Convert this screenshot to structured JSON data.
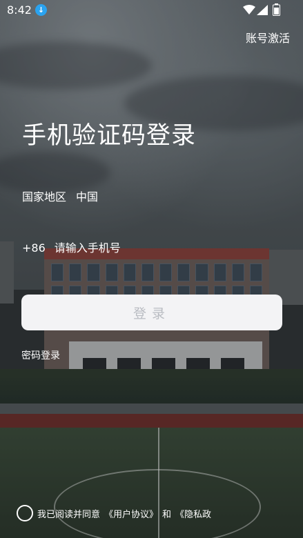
{
  "status_bar": {
    "time": "8:42",
    "download_icon": "download-icon",
    "wifi_icon": "wifi-icon",
    "signal_icon": "signal-icon",
    "battery_icon": "battery-icon"
  },
  "header": {
    "account_activate": "账号激活"
  },
  "main": {
    "title": "手机验证码登录",
    "region_label": "国家地区",
    "region_value": "中国",
    "country_code": "+86",
    "phone_placeholder": "请输入手机号",
    "login_button": "登录",
    "password_login": "密码登录"
  },
  "footer": {
    "agreement_prefix": "我已阅读并同意",
    "user_agreement": "《用户协议》",
    "conjunction": "和",
    "privacy_policy": "《隐私政"
  },
  "colors": {
    "button_bg": "#f3f3f5",
    "button_text": "#b9bcc2",
    "badge_blue": "#2aa3f0"
  }
}
